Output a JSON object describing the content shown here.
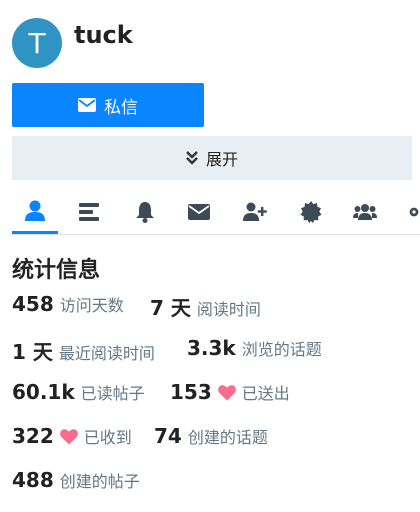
{
  "profile": {
    "avatar_letter": "T",
    "username": "tuck",
    "avatar_color": "#2f94c4"
  },
  "actions": {
    "message_label": "私信",
    "expand_label": "展开"
  },
  "tabs": [
    {
      "name": "summary",
      "icon": "user-icon",
      "active": true
    },
    {
      "name": "activity",
      "icon": "list-icon"
    },
    {
      "name": "notifications",
      "icon": "bell-icon"
    },
    {
      "name": "messages",
      "icon": "envelope-icon"
    },
    {
      "name": "invites",
      "icon": "user-plus-icon"
    },
    {
      "name": "badges",
      "icon": "badge-icon"
    },
    {
      "name": "groups",
      "icon": "users-icon"
    }
  ],
  "stats": {
    "title": "统计信息",
    "items": [
      {
        "value": "458",
        "label": "访问天数"
      },
      {
        "value": "7 天",
        "label": "阅读时间"
      },
      {
        "value": "1 天",
        "label": "最近阅读时间"
      },
      {
        "value": "3.3k",
        "label": "浏览的话题"
      },
      {
        "value": "60.1k",
        "label": "已读帖子"
      },
      {
        "value": "153",
        "label": "已送出"
      },
      {
        "value": "322",
        "label": "已收到"
      },
      {
        "value": "74",
        "label": "创建的话题"
      },
      {
        "value": "488",
        "label": "创建的帖子"
      }
    ]
  },
  "colors": {
    "primary": "#0a84ff",
    "muted": "#647887",
    "heart": "#fa6c8d",
    "icon": "#3d4a57"
  }
}
